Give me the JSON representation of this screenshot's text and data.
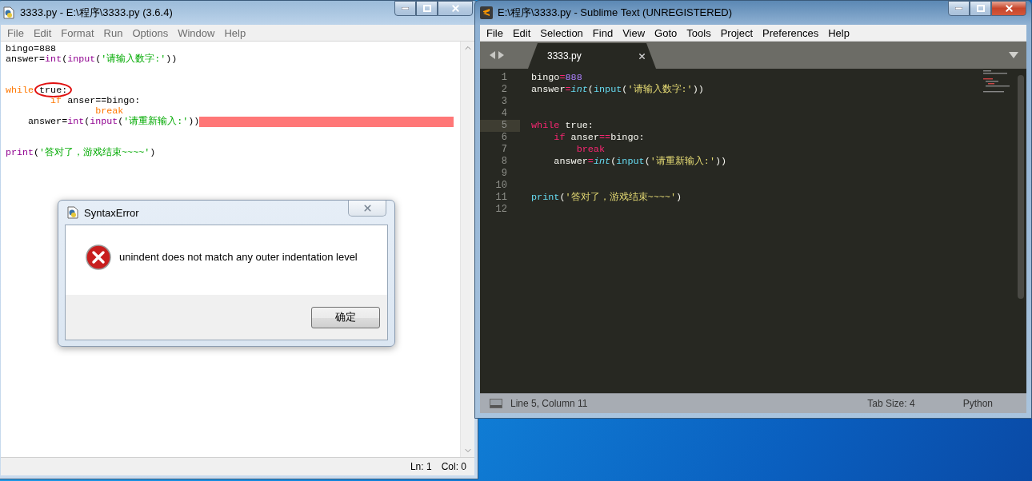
{
  "idle": {
    "title": "3333.py - E:\\程序\\3333.py (3.6.4)",
    "menu": [
      "File",
      "Edit",
      "Format",
      "Run",
      "Options",
      "Window",
      "Help"
    ],
    "lines": [
      {
        "error": false,
        "tokens": [
          {
            "text": "bingo=888",
            "kind": "plain",
            "circled": false
          }
        ]
      },
      {
        "error": false,
        "tokens": [
          {
            "text": "answer=",
            "kind": "plain",
            "circled": false
          },
          {
            "text": "int",
            "kind": "builtin",
            "circled": false
          },
          {
            "text": "(",
            "kind": "plain",
            "circled": false
          },
          {
            "text": "input",
            "kind": "builtin",
            "circled": false
          },
          {
            "text": "(",
            "kind": "plain",
            "circled": false
          },
          {
            "text": "'请输入数字:'",
            "kind": "string",
            "circled": false
          },
          {
            "text": "))",
            "kind": "plain",
            "circled": false
          }
        ]
      },
      {
        "error": false
      },
      {
        "error": false
      },
      {
        "error": false,
        "tokens": [
          {
            "text": "while ",
            "kind": "keyword",
            "circled": false
          },
          {
            "text": "true:",
            "kind": "plain",
            "circled": true
          }
        ]
      },
      {
        "error": false,
        "tokens": [
          {
            "text": "        if",
            "kind": "keyword",
            "circled": false
          },
          {
            "text": " anser==bingo:",
            "kind": "plain",
            "circled": false
          }
        ]
      },
      {
        "error": false,
        "tokens": [
          {
            "text": "                break",
            "kind": "keyword",
            "circled": false
          }
        ]
      },
      {
        "error": true,
        "tokens": [
          {
            "text": "    answer=",
            "kind": "plain",
            "circled": false
          },
          {
            "text": "int",
            "kind": "builtin",
            "circled": false
          },
          {
            "text": "(",
            "kind": "plain",
            "circled": false
          },
          {
            "text": "input",
            "kind": "builtin",
            "circled": false
          },
          {
            "text": "(",
            "kind": "plain",
            "circled": false
          },
          {
            "text": "'请重新输入:'",
            "kind": "string",
            "circled": false
          },
          {
            "text": "))",
            "kind": "plain",
            "circled": false
          }
        ]
      },
      {
        "error": false
      },
      {
        "error": false
      },
      {
        "error": false,
        "tokens": [
          {
            "text": "print",
            "kind": "builtin",
            "circled": false
          },
          {
            "text": "(",
            "kind": "plain",
            "circled": false
          },
          {
            "text": "'答对了，游戏结束~~~~'",
            "kind": "string",
            "circled": false
          },
          {
            "text": ")",
            "kind": "plain",
            "circled": false
          }
        ]
      }
    ],
    "status": [
      "Ln: 1",
      "Col: 0"
    ]
  },
  "dialog": {
    "title": "SyntaxError",
    "message": "unindent does not match any outer indentation level",
    "button": "确定"
  },
  "sublime": {
    "title": "E:\\程序\\3333.py - Sublime Text (UNREGISTERED)",
    "menu": [
      "File",
      "Edit",
      "Selection",
      "Find",
      "View",
      "Goto",
      "Tools",
      "Project",
      "Preferences",
      "Help"
    ],
    "tabs": [
      {
        "label": "3333.py",
        "selected": true
      }
    ],
    "lines": [
      {
        "number": "1",
        "current": false,
        "tokens": [
          {
            "text": "bingo",
            "kind": "plain"
          },
          {
            "text": "=",
            "kind": "operator"
          },
          {
            "text": "888",
            "kind": "number"
          }
        ]
      },
      {
        "number": "2",
        "current": false,
        "tokens": [
          {
            "text": "answer",
            "kind": "plain"
          },
          {
            "text": "=",
            "kind": "operator"
          },
          {
            "text": "int",
            "kind": "type"
          },
          {
            "text": "(",
            "kind": "plain"
          },
          {
            "text": "input",
            "kind": "function"
          },
          {
            "text": "(",
            "kind": "plain"
          },
          {
            "text": "'请输入数字:'",
            "kind": "string"
          },
          {
            "text": "))",
            "kind": "plain"
          }
        ]
      },
      {
        "number": "3",
        "current": false
      },
      {
        "number": "4",
        "current": false
      },
      {
        "number": "5",
        "current": true,
        "tokens": [
          {
            "text": "while",
            "kind": "keyword"
          },
          {
            "text": " true:",
            "kind": "plain"
          }
        ]
      },
      {
        "number": "6",
        "current": false,
        "tokens": [
          {
            "text": "    if",
            "kind": "keyword"
          },
          {
            "text": " anser",
            "kind": "plain"
          },
          {
            "text": "==",
            "kind": "operator"
          },
          {
            "text": "bingo:",
            "kind": "plain"
          }
        ]
      },
      {
        "number": "7",
        "current": false,
        "tokens": [
          {
            "text": "        break",
            "kind": "keyword"
          }
        ]
      },
      {
        "number": "8",
        "current": false,
        "tokens": [
          {
            "text": "    answer",
            "kind": "plain"
          },
          {
            "text": "=",
            "kind": "operator"
          },
          {
            "text": "int",
            "kind": "type"
          },
          {
            "text": "(",
            "kind": "plain"
          },
          {
            "text": "input",
            "kind": "function"
          },
          {
            "text": "(",
            "kind": "plain"
          },
          {
            "text": "'请重新输入:'",
            "kind": "string"
          },
          {
            "text": "))",
            "kind": "plain"
          }
        ]
      },
      {
        "number": "9",
        "current": false
      },
      {
        "number": "10",
        "current": false
      },
      {
        "number": "11",
        "current": false,
        "tokens": [
          {
            "text": "print",
            "kind": "function"
          },
          {
            "text": "(",
            "kind": "plain"
          },
          {
            "text": "'答对了，游戏结束~~~~'",
            "kind": "string"
          },
          {
            "text": ")",
            "kind": "plain"
          }
        ]
      },
      {
        "number": "12",
        "current": false
      }
    ],
    "status": {
      "position": "Line 5, Column 11",
      "tab_size": "Tab Size: 4",
      "syntax": "Python"
    }
  }
}
